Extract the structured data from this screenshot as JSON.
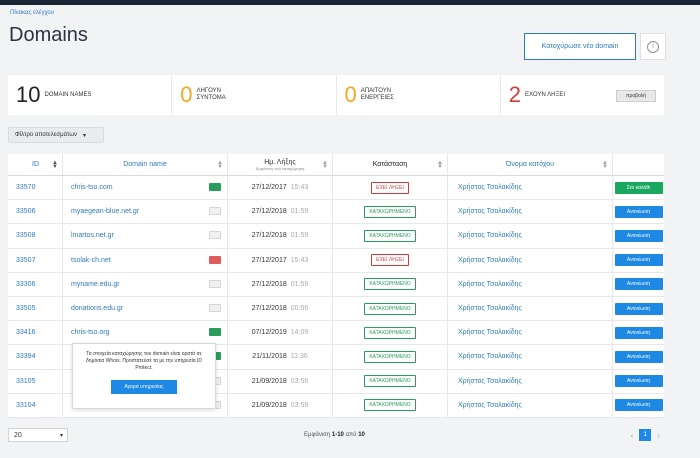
{
  "breadcrumb": "Πίνακας ελέγχου",
  "page_title": "Domains",
  "register_button": "Κατοχύρωσε νέο domain",
  "info_icon": "i",
  "stats": [
    {
      "value": "10",
      "label": "DOMAIN NAMES",
      "color": "#222222"
    },
    {
      "value": "0",
      "label": "ΛΗΓΟΥΝ ΣΥΝΤΟΜΑ",
      "color": "#f5a623"
    },
    {
      "value": "0",
      "label": "ΑΠΑΙΤΟΥΝ ΕΝΕΡΓΕΙΕΣ",
      "color": "#f5a623"
    },
    {
      "value": "2",
      "label": "ΕΧΟΥΝ ΛΗΞΕΙ",
      "color": "#d63a3a",
      "button": "προβολή"
    }
  ],
  "filter_label": "Φίλτρο αποτελεσμάτων",
  "columns": {
    "id": "ID",
    "domain": "Domain name",
    "date": "Ημ. Λήξης",
    "date_sub": "Εμφάνιση ανά καταχώρηση",
    "status": "Κατάσταση",
    "owner": "Όνομα κατόχου"
  },
  "rows": [
    {
      "id": "33570",
      "domain": "chris-tso.com",
      "date": "27/12/2017",
      "time": "15:43",
      "status": "EXEI ΛΗΞΕΙ",
      "status_kind": "red",
      "owner": "Χρήστος Τσολακίδης",
      "action": "Στο καλάθι",
      "action_kind": "green",
      "whois": "g"
    },
    {
      "id": "33506",
      "domain": "myaegean-blue.net.gr",
      "date": "27/12/2018",
      "time": "01:59",
      "status": "ΚΑΤΑΧΩΡΗΜΕΝΟ",
      "status_kind": "green",
      "owner": "Χρήστος Τσολακίδης",
      "action": "Ανανέωση",
      "action_kind": "blue",
      "whois": "n"
    },
    {
      "id": "33508",
      "domain": "lmartos.net.gr",
      "date": "27/12/2018",
      "time": "01:59",
      "status": "ΚΑΤΑΧΩΡΗΜΕΝΟ",
      "status_kind": "green",
      "owner": "Χρήστος Τσολακίδης",
      "action": "Ανανέωση",
      "action_kind": "blue",
      "whois": "n"
    },
    {
      "id": "33507",
      "domain": "tsolak-ch.net",
      "date": "27/12/2017",
      "time": "15:43",
      "status": "EXEI ΛΗΞΕΙ",
      "status_kind": "red",
      "owner": "Χρήστος Τσολακίδης",
      "action": "Ανανέωση",
      "action_kind": "blue",
      "whois": "r"
    },
    {
      "id": "33306",
      "domain": "myname.edu.gr",
      "date": "27/12/2018",
      "time": "01:59",
      "status": "ΚΑΤΑΧΩΡΗΜΕΝΟ",
      "status_kind": "green",
      "owner": "Χρήστος Τσολακίδης",
      "action": "Ανανέωση",
      "action_kind": "blue",
      "whois": "n"
    },
    {
      "id": "33505",
      "domain": "donations.edu.gr",
      "date": "27/12/2018",
      "time": "00:56",
      "status": "ΚΑΤΑΧΩΡΗΜΕΝΟ",
      "status_kind": "green",
      "owner": "Χρήστος Τσολακίδης",
      "action": "Ανανέωση",
      "action_kind": "blue",
      "whois": "n"
    },
    {
      "id": "33416",
      "domain": "chris-tso.org",
      "date": "07/12/2019",
      "time": "14:09",
      "status": "ΚΑΤΑΧΩΡΗΜΕΝΟ",
      "status_kind": "green",
      "owner": "Χρήστος Τσολακίδης",
      "action": "Ανανέωση",
      "action_kind": "blue",
      "whois": "g"
    },
    {
      "id": "33394",
      "domain": "",
      "date": "21/11/2018",
      "time": "11:36",
      "status": "ΚΑΤΑΧΩΡΗΜΕΝΟ",
      "status_kind": "green",
      "owner": "Χρήστος Τσολακίδης",
      "action": "Ανανέωση",
      "action_kind": "blue",
      "whois": "g"
    },
    {
      "id": "33105",
      "domain": "",
      "date": "21/09/2018",
      "time": "03:56",
      "status": "ΚΑΤΑΧΩΡΗΜΕΝΟ",
      "status_kind": "green",
      "owner": "Χρήστος Τσολακίδης",
      "action": "Ανανέωση",
      "action_kind": "blue",
      "whois": "n"
    },
    {
      "id": "33104",
      "domain": "",
      "date": "21/09/2018",
      "time": "03:59",
      "status": "ΚΑΤΑΧΩΡΗΜΕΝΟ",
      "status_kind": "green",
      "owner": "Χρήστος Τσολακίδης",
      "action": "Ανανέωση",
      "action_kind": "blue",
      "whois": "n"
    }
  ],
  "popup": {
    "text": "Τα στοιχεία καταχώρησης του domain είναι ορατά σε δημόσια Whois. Προστατεύσέ τα με την υπηρεσία ID Protect.",
    "button": "Αγορά υπηρεσίας"
  },
  "footer": {
    "per_page": "20",
    "showing_prefix": "Εμφάνιση",
    "showing_range": "1-10",
    "showing_mid": "από",
    "showing_total": "10",
    "current_page": "1"
  }
}
